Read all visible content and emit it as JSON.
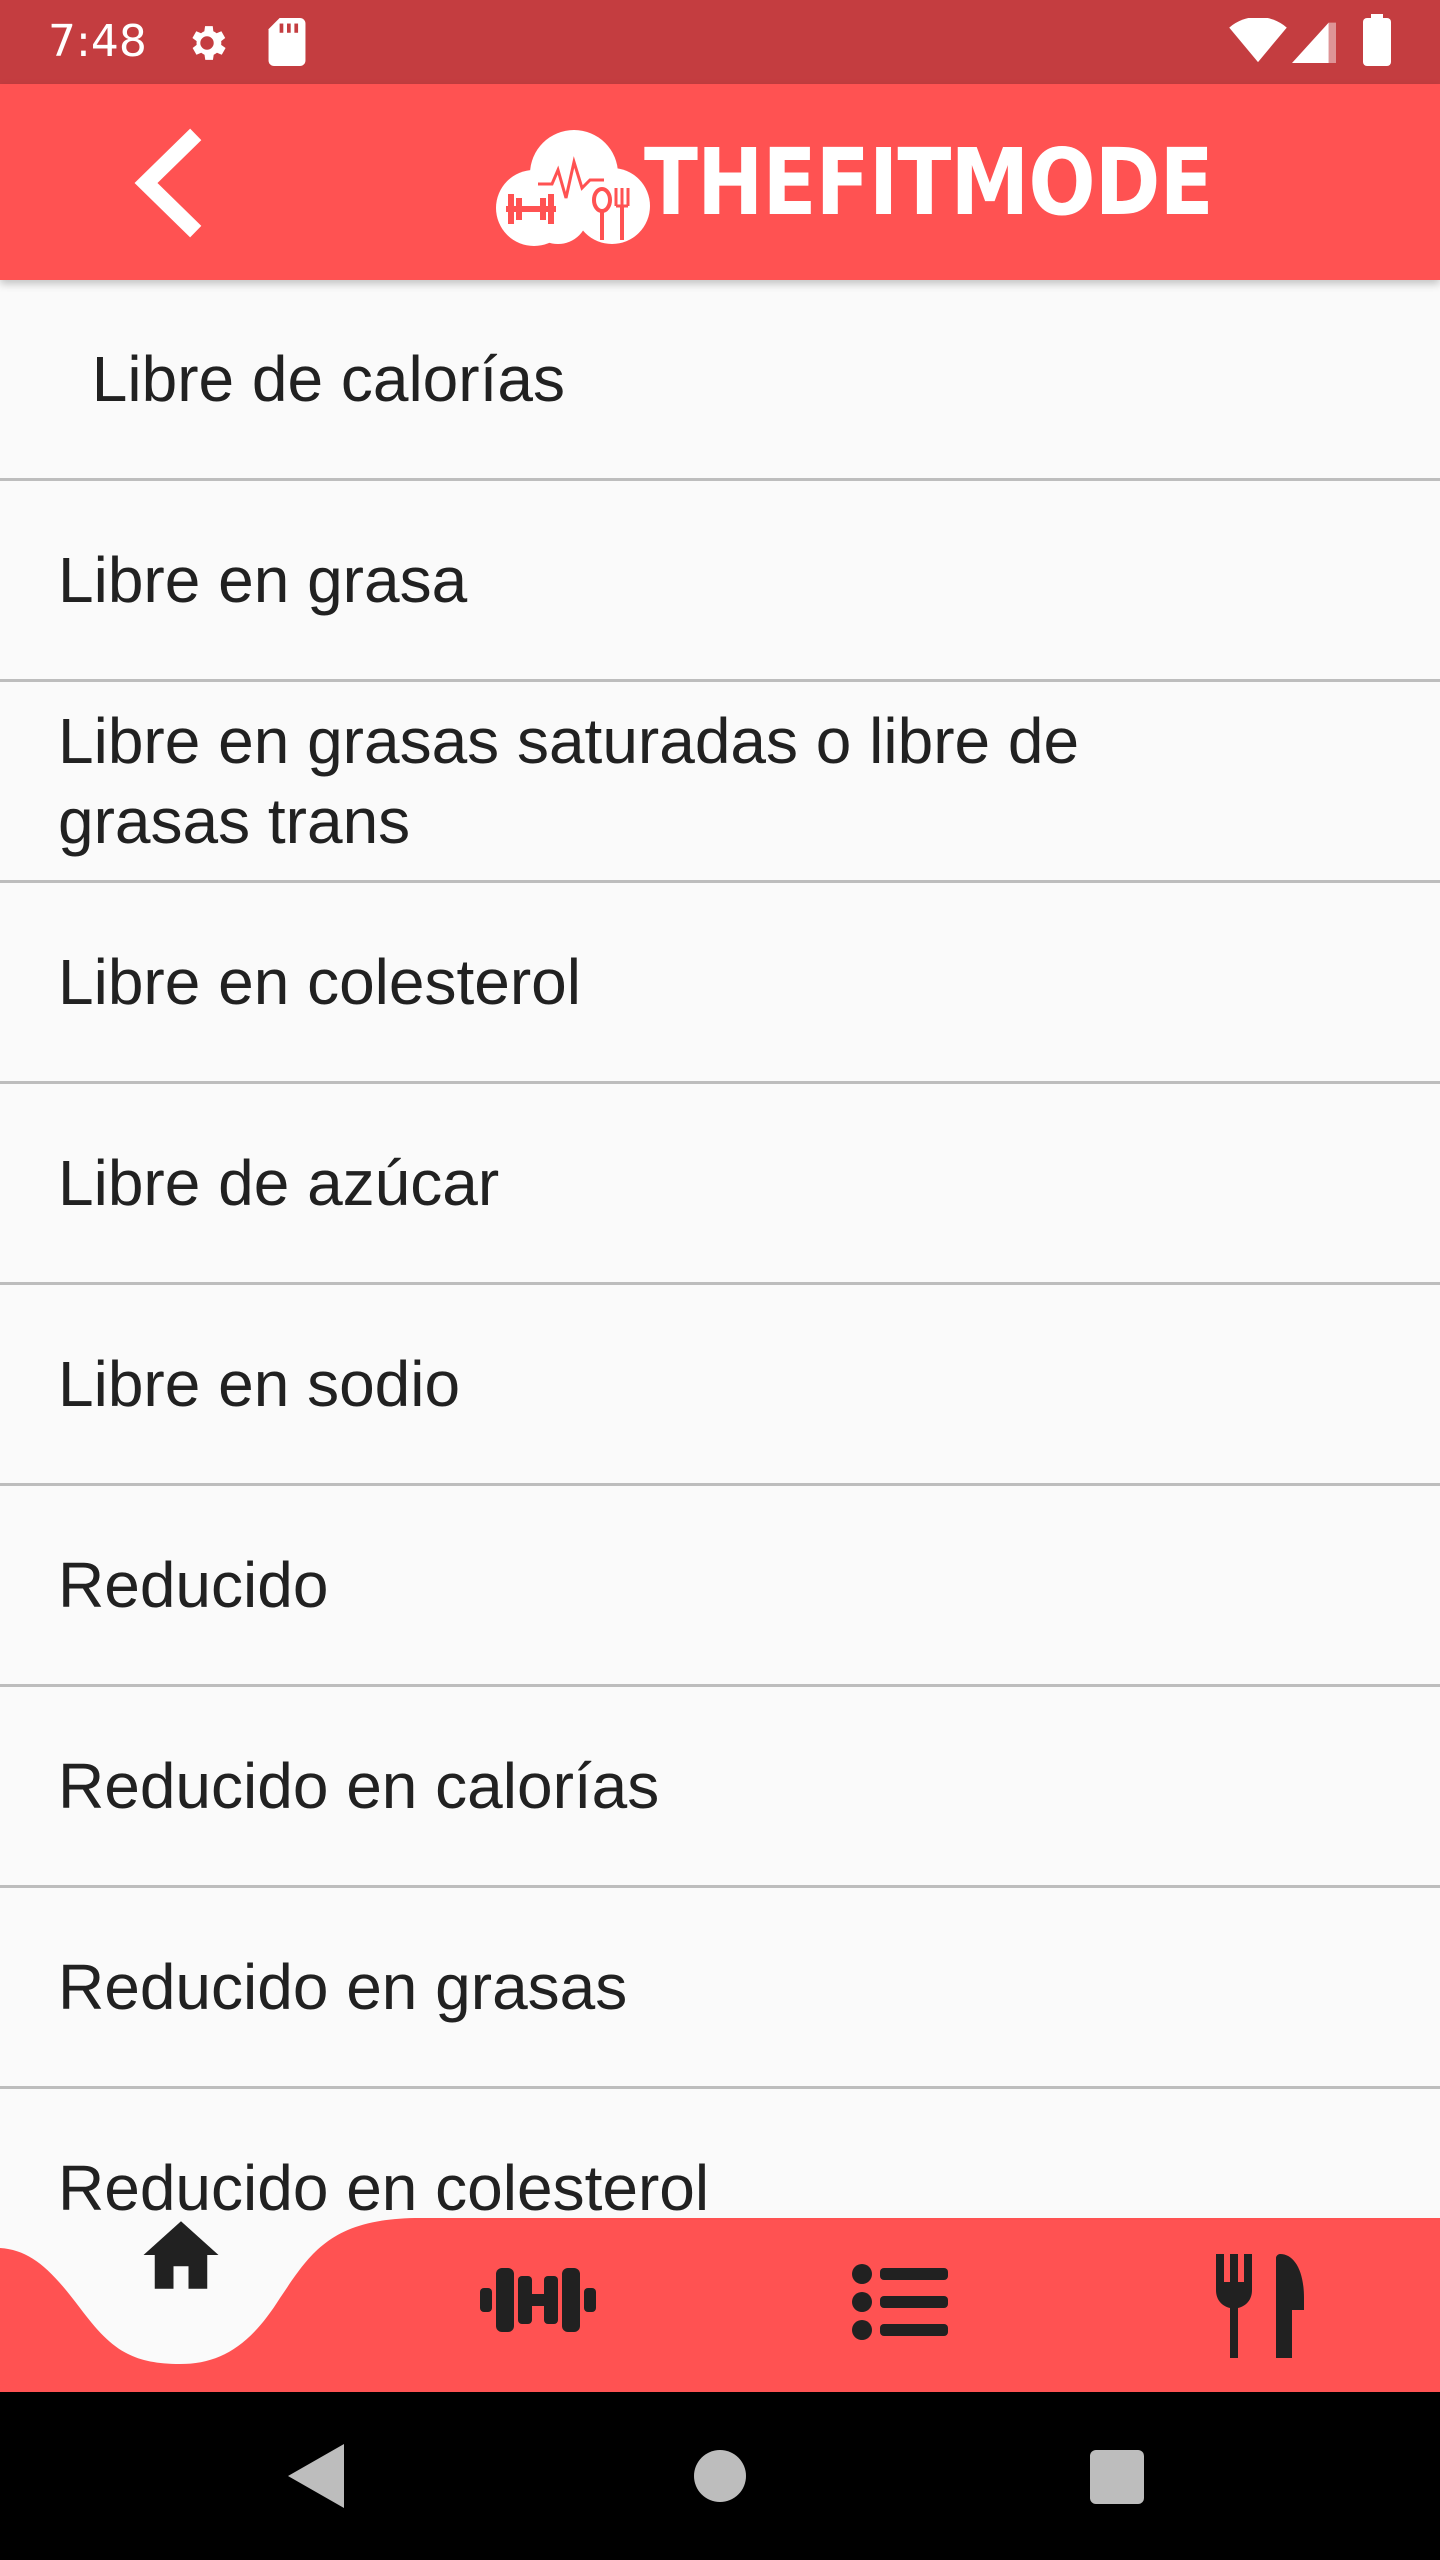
{
  "status_bar": {
    "time": "7:48",
    "icons": [
      "gear-icon",
      "sd-card-icon",
      "wifi-icon",
      "cellular-signal-icon",
      "battery-icon"
    ]
  },
  "app_bar": {
    "back_icon": "chevron-left-icon",
    "logo_text": "THEFITMODE",
    "background_color": "#ff5252"
  },
  "list": {
    "items": [
      {
        "label": " Libre de calorías"
      },
      {
        "label": "Libre en grasa"
      },
      {
        "label": "Libre en grasas saturadas o libre de grasas trans"
      },
      {
        "label": "Libre en colesterol"
      },
      {
        "label": "Libre de azúcar"
      },
      {
        "label": "Libre en sodio"
      },
      {
        "label": "Reducido"
      },
      {
        "label": "Reducido en calorías"
      },
      {
        "label": "Reducido en grasas"
      },
      {
        "label": "Reducido en colesterol"
      }
    ]
  },
  "bottom_nav": {
    "items": [
      {
        "icon": "home-icon",
        "selected": true
      },
      {
        "icon": "dumbbell-icon",
        "selected": false
      },
      {
        "icon": "list-icon",
        "selected": false
      },
      {
        "icon": "fork-knife-icon",
        "selected": false
      }
    ],
    "background_color": "#ff5252"
  },
  "system_nav": {
    "icons": [
      "back-triangle-icon",
      "home-circle-icon",
      "recents-square-icon"
    ]
  }
}
